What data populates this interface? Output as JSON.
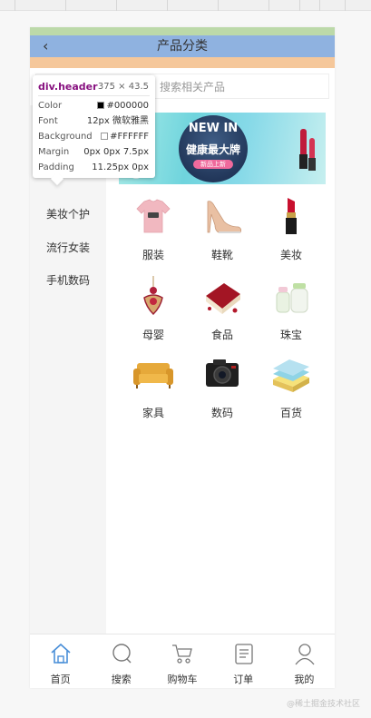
{
  "header": {
    "back_icon": "‹",
    "title": "产品分类"
  },
  "search": {
    "placeholder": "搜索相关产品"
  },
  "sidebar": {
    "items": [
      "美妆个护",
      "流行女装",
      "手机数码"
    ]
  },
  "banner": {
    "headline": "NEW IN",
    "sub": "健康最大牌",
    "tag": "新品上新"
  },
  "grid": {
    "items": [
      {
        "label": "服装",
        "icon": "tshirt-icon"
      },
      {
        "label": "鞋靴",
        "icon": "high-heel-icon"
      },
      {
        "label": "美妆",
        "icon": "lipstick-icon"
      },
      {
        "label": "母婴",
        "icon": "pendant-icon"
      },
      {
        "label": "食品",
        "icon": "cake-icon"
      },
      {
        "label": "珠宝",
        "icon": "baby-bottle-icon"
      },
      {
        "label": "家具",
        "icon": "sofa-icon"
      },
      {
        "label": "数码",
        "icon": "camera-icon"
      },
      {
        "label": "百货",
        "icon": "stacked-boxes-icon"
      }
    ]
  },
  "tabbar": {
    "items": [
      {
        "label": "首页",
        "icon": "home-icon",
        "active": true
      },
      {
        "label": "搜索",
        "icon": "search-icon",
        "active": false
      },
      {
        "label": "购物车",
        "icon": "cart-icon",
        "active": false
      },
      {
        "label": "订单",
        "icon": "order-icon",
        "active": false
      },
      {
        "label": "我的",
        "icon": "user-icon",
        "active": false
      }
    ]
  },
  "inspector": {
    "selector": "div.header",
    "dimensions": "375 × 43.5",
    "rows": [
      {
        "key": "Color",
        "value": "#000000",
        "swatch": "#000000"
      },
      {
        "key": "Font",
        "value": "12px 微软雅黑"
      },
      {
        "key": "Background",
        "value": "#FFFFFF",
        "swatch": "#FFFFFF"
      },
      {
        "key": "Margin",
        "value": "0px 0px 7.5px"
      },
      {
        "key": "Padding",
        "value": "11.25px 0px"
      }
    ]
  },
  "watermark": "@稀土掘金技术社区",
  "colors": {
    "accent": "#4a8fd8",
    "header_margin": "#bcd9a9",
    "header_padding": "#8fb2e0",
    "sidebar_bg": "#f5f5f5"
  }
}
